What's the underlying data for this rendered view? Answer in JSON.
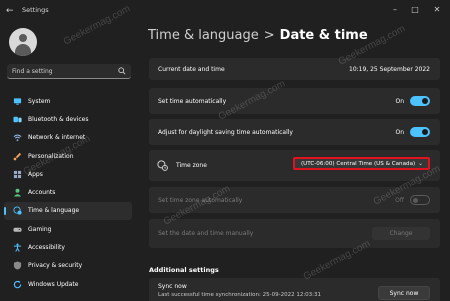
{
  "window": {
    "title": "Settings"
  },
  "search": {
    "placeholder": "Find a setting"
  },
  "sidebar": {
    "items": [
      {
        "label": "System",
        "icon": "monitor-icon",
        "color": "#4cc2ff"
      },
      {
        "label": "Bluetooth & devices",
        "icon": "bluetooth-icon",
        "color": "#4cc2ff"
      },
      {
        "label": "Network & internet",
        "icon": "wifi-icon",
        "color": "#8fb4e8"
      },
      {
        "label": "Personalization",
        "icon": "brush-icon",
        "color": "#f0a35e"
      },
      {
        "label": "Apps",
        "icon": "apps-icon",
        "color": "#9aa7c6"
      },
      {
        "label": "Accounts",
        "icon": "person-icon",
        "color": "#58c37a"
      },
      {
        "label": "Time & language",
        "icon": "globe-clock-icon",
        "color": "#4cc2ff",
        "active": true
      },
      {
        "label": "Gaming",
        "icon": "gamepad-icon",
        "color": "#b7b7b7"
      },
      {
        "label": "Accessibility",
        "icon": "accessibility-icon",
        "color": "#4cc2ff"
      },
      {
        "label": "Privacy & security",
        "icon": "shield-icon",
        "color": "#8a8a8a"
      },
      {
        "label": "Windows Update",
        "icon": "update-icon",
        "color": "#4cc2ff"
      }
    ]
  },
  "breadcrumb": {
    "parent": "Time & language",
    "separator": ">",
    "current": "Date & time"
  },
  "settings": {
    "current_date_label": "Current date and time",
    "current_date_value": "10:19, 25 September 2022",
    "set_auto_label": "Set time automatically",
    "set_auto_state": "On",
    "dst_label": "Adjust for daylight saving time automatically",
    "dst_state": "On",
    "timezone_label": "Time zone",
    "timezone_value": "(UTC-06:00) Central Time (US & Canada)",
    "tz_auto_label": "Set time zone automatically",
    "tz_auto_state": "Off",
    "manual_label": "Set the date and time manually",
    "manual_button": "Change"
  },
  "additional": {
    "title": "Additional settings",
    "sync_title": "Sync now",
    "sync_sub": "Last successful time synchronization: 25-09-2022 12:03:31",
    "sync_button": "Sync now"
  },
  "watermark": "Geekermag.com",
  "colors": {
    "accent": "#4cc2ff",
    "highlight": "#e0141e"
  }
}
